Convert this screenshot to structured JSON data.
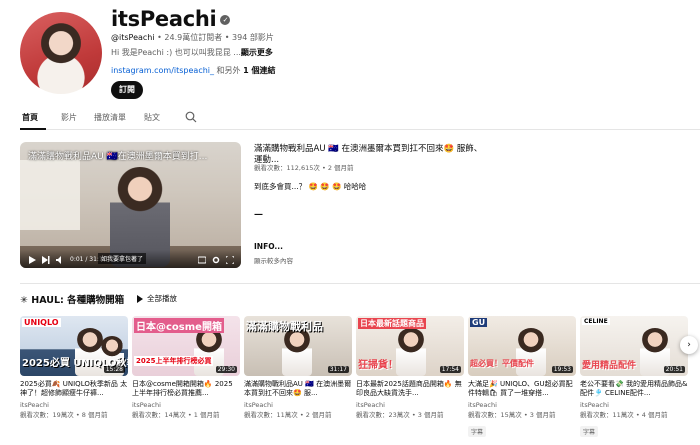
{
  "channel": {
    "name": "itsPeachi",
    "handle": "@itsPeachi",
    "stats": " • 24.9萬位訂閱者 • 394 部影片",
    "desc_prefix": "Hi 我是Peachi :) 也可以叫我昆昆 ...",
    "desc_more": "顯示更多",
    "link_url": "instagram.com/itspeachi_",
    "link_suffix": " 和另外 ",
    "link_count": "1 個連結",
    "subscribe_label": "訂閱"
  },
  "tabs": [
    {
      "label": "首頁"
    },
    {
      "label": "影片"
    },
    {
      "label": "播放清單"
    },
    {
      "label": "貼文"
    }
  ],
  "featured": {
    "overlay_title": "滿滿購物戰利品AU 🇦🇺在澳洲墨爾本買到打...",
    "time": "0:01 / 31:17",
    "subtitle": "如我要拿包著了",
    "title": "滿滿購物戰利品AU 🇦🇺 在澳洲墨爾本買到扛不回來🤩 服飾、運動...",
    "meta": "觀看次數：112,615次 • 2 個月前",
    "desc": "到底多會買...？ 🤩 🤩 🤩 哈哈哈",
    "dash": "—",
    "more_label": "INFO...",
    "more_meta": "顯示較多內容"
  },
  "shelf": {
    "title": "✳ HAUL: 各種購物開箱",
    "play_all": "全部播放",
    "videos": [
      {
        "thumb_top": "UNIQLO",
        "thumb_bottom": "2025必買 UNIQLO秋季",
        "duration": "15:28",
        "title": "2025必買🍂 UNIQLO秋季新品 太神了！超修飾顯瘦牛仔褲...",
        "channel": "itsPeachi",
        "meta": "觀看次數：19萬次 • 8 個月前",
        "badge": ""
      },
      {
        "thumb_top": "日本@cosme開箱",
        "thumb_bottom": "2025上半年排行榜必買",
        "duration": "29:30",
        "title": "日本@cosme開箱開箱🔥 2025 上半年排行榜必買推薦...",
        "channel": "itsPeachi",
        "meta": "觀看次數：14萬次 • 1 個月前",
        "badge": ""
      },
      {
        "thumb_top": "滿滿購物戰利品",
        "thumb_bottom": "",
        "duration": "31:17",
        "title": "滿滿購物戰利品AU 🇦🇺 在澳洲墨爾本買到扛不回來🤩 服...",
        "channel": "itsPeachi",
        "meta": "觀看次數：11萬次 • 2 個月前",
        "badge": ""
      },
      {
        "thumb_top": "日本最新話題商品",
        "thumb_bottom": "狂掃貨！",
        "duration": "17:54",
        "title": "日本最新2025話題商品開箱🔥 無印良品大缺貨洗手...",
        "channel": "itsPeachi",
        "meta": "觀看次數：23萬次 • 3 個月前",
        "badge": ""
      },
      {
        "thumb_top": "GU",
        "thumb_bottom": "超必買！平價配件",
        "duration": "19:53",
        "title": "大滿足🎉 UNIQLO、GU超必買配件特輯🛍 買了一堆穿搭...",
        "channel": "itsPeachi",
        "meta": "觀看次數：15萬次 • 3 個月前",
        "badge": "字幕"
      },
      {
        "thumb_top": "CELINE",
        "thumb_bottom": "愛用精品配件",
        "duration": "20:51",
        "title": "老公不要看💸 我的愛用精品飾品&配件🎐 CELINE配件...",
        "channel": "itsPeachi",
        "meta": "觀看次數：11萬次 • 4 個月前",
        "badge": "字幕"
      }
    ]
  },
  "colors": {
    "accent_link": "#065fd4",
    "text_primary": "#0f0f0f",
    "text_secondary": "#606060"
  },
  "icons": {
    "verified": "verified-check-icon",
    "search": "search-icon",
    "next": "chevron-right-icon"
  }
}
